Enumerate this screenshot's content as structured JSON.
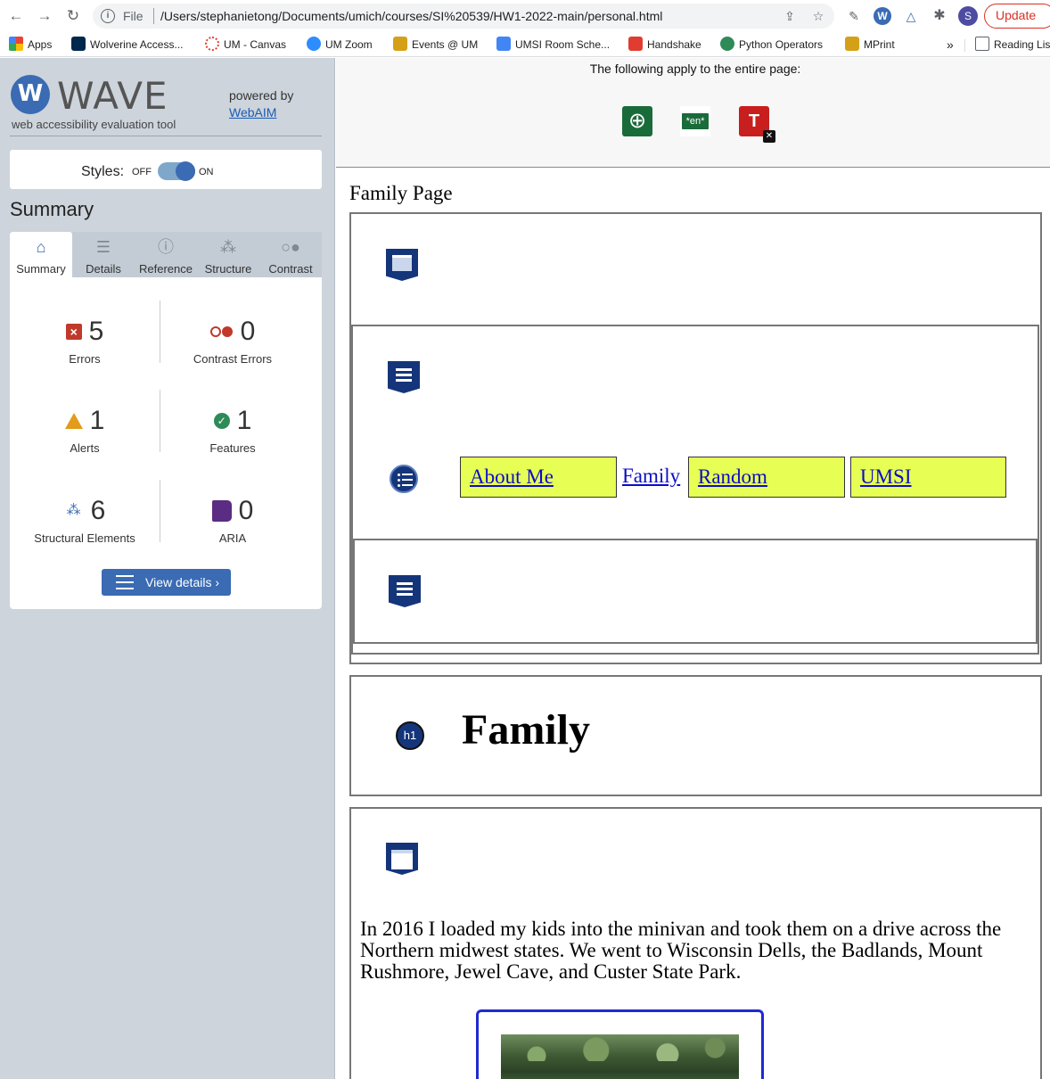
{
  "browser": {
    "scheme": "File",
    "url": "/Users/stephanietong/Documents/umich/courses/SI%20539/HW1-2022-main/personal.html",
    "profile_initial": "S",
    "update_label": "Update",
    "bookmarks": [
      {
        "label": "Apps",
        "color": "#4285f4"
      },
      {
        "label": "Wolverine Access...",
        "color": "#00274c"
      },
      {
        "label": "UM - Canvas",
        "color": "#e03c31"
      },
      {
        "label": "UM Zoom",
        "color": "#2d8cff"
      },
      {
        "label": "Events @ UM",
        "color": "#d4a017"
      },
      {
        "label": "UMSI Room Sche...",
        "color": "#4285f4"
      },
      {
        "label": "Handshake",
        "color": "#e03c31"
      },
      {
        "label": "Python Operators",
        "color": "#2e8b57"
      },
      {
        "label": "MPrint",
        "color": "#d4a017"
      }
    ],
    "more_bookmarks": "»",
    "reading_list": "Reading List"
  },
  "wave": {
    "logo_letter": "W",
    "logo_word": "WAVE",
    "tagline": "web accessibility evaluation tool",
    "powered_by": "powered by",
    "webaim": "WebAIM",
    "styles_label": "Styles:",
    "styles_off": "OFF",
    "styles_on": "ON",
    "summary_title": "Summary",
    "tabs": [
      {
        "label": "Summary",
        "icon": "home-icon"
      },
      {
        "label": "Details",
        "icon": "list-icon"
      },
      {
        "label": "Reference",
        "icon": "info-icon"
      },
      {
        "label": "Structure",
        "icon": "hierarchy-icon"
      },
      {
        "label": "Contrast",
        "icon": "contrast-icon"
      }
    ],
    "stats": {
      "errors": {
        "value": "5",
        "label": "Errors"
      },
      "contrast_errors": {
        "value": "0",
        "label": "Contrast Errors"
      },
      "alerts": {
        "value": "1",
        "label": "Alerts"
      },
      "features": {
        "value": "1",
        "label": "Features"
      },
      "structural": {
        "value": "6",
        "label": "Structural Elements"
      },
      "aria": {
        "value": "0",
        "label": "ARIA"
      }
    },
    "view_details": "View details ›",
    "accent": "#3a6bb3",
    "error_color": "#c0392b"
  },
  "page": {
    "applies_text": "The following apply to the entire page:",
    "lang_badge": "*en*",
    "title_badge": "T",
    "title": "Family Page",
    "nav_links": [
      "About Me",
      "Family",
      "Random",
      "UMSI"
    ],
    "heading_badge": "h1",
    "heading": "Family",
    "paragraph": "In 2016 I loaded my kids into the minivan and took them on a drive across the Northern midwest states. We went to Wisconsin Dells, the Badlands, Mount Rushmore, Jewel Cave, and Custer State Park.",
    "link_highlight": "#e7ff55"
  }
}
